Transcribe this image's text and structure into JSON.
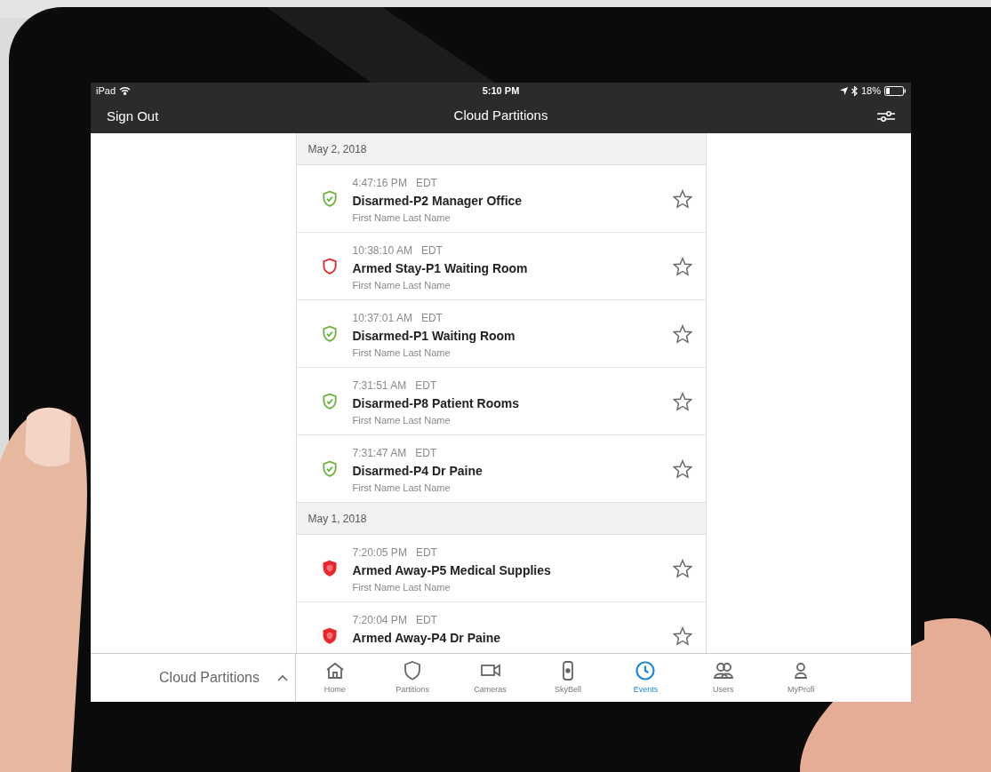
{
  "status_bar": {
    "carrier": "iPad",
    "time": "5:10 PM",
    "battery": "18%"
  },
  "nav_bar": {
    "left": "Sign Out",
    "title": "Cloud Partitions"
  },
  "event_groups": [
    {
      "date": "May 2, 2018",
      "events": [
        {
          "time": "4:47:16 PM",
          "zone": "EDT",
          "title": "Disarmed-P2 Manager Office",
          "user": "First Name Last Name",
          "kind": "disarmed",
          "starred": false
        },
        {
          "time": "10:38:10 AM",
          "zone": "EDT",
          "title": "Armed Stay-P1 Waiting Room",
          "user": "First Name Last Name",
          "kind": "stay",
          "starred": false
        },
        {
          "time": "10:37:01 AM",
          "zone": "EDT",
          "title": "Disarmed-P1 Waiting Room",
          "user": "First Name Last Name",
          "kind": "disarmed",
          "starred": false
        },
        {
          "time": "7:31:51 AM",
          "zone": "EDT",
          "title": "Disarmed-P8 Patient Rooms",
          "user": "First Name Last Name",
          "kind": "disarmed",
          "starred": false
        },
        {
          "time": "7:31:47 AM",
          "zone": "EDT",
          "title": "Disarmed-P4 Dr Paine",
          "user": "First Name Last Name",
          "kind": "disarmed",
          "starred": false
        }
      ]
    },
    {
      "date": "May 1, 2018",
      "events": [
        {
          "time": "7:20:05 PM",
          "zone": "EDT",
          "title": "Armed Away-P5 Medical Supplies",
          "user": "First Name Last Name",
          "kind": "away",
          "starred": false
        },
        {
          "time": "7:20:04 PM",
          "zone": "EDT",
          "title": "Armed Away-P4 Dr Paine",
          "kind": "away",
          "starred": false
        }
      ]
    }
  ],
  "bottom_bar": {
    "picker": "Cloud Partitions",
    "tabs": [
      {
        "label": "Home",
        "kind": "home",
        "selected": false
      },
      {
        "label": "Partitions",
        "kind": "shield",
        "selected": false
      },
      {
        "label": "Cameras",
        "kind": "camera",
        "selected": false
      },
      {
        "label": "SkyBell",
        "kind": "doorbell",
        "selected": false
      },
      {
        "label": "Events",
        "kind": "clock",
        "selected": true
      },
      {
        "label": "Users",
        "kind": "users",
        "selected": false
      },
      {
        "label": "MyProfi",
        "kind": "user",
        "selected": false
      }
    ]
  }
}
